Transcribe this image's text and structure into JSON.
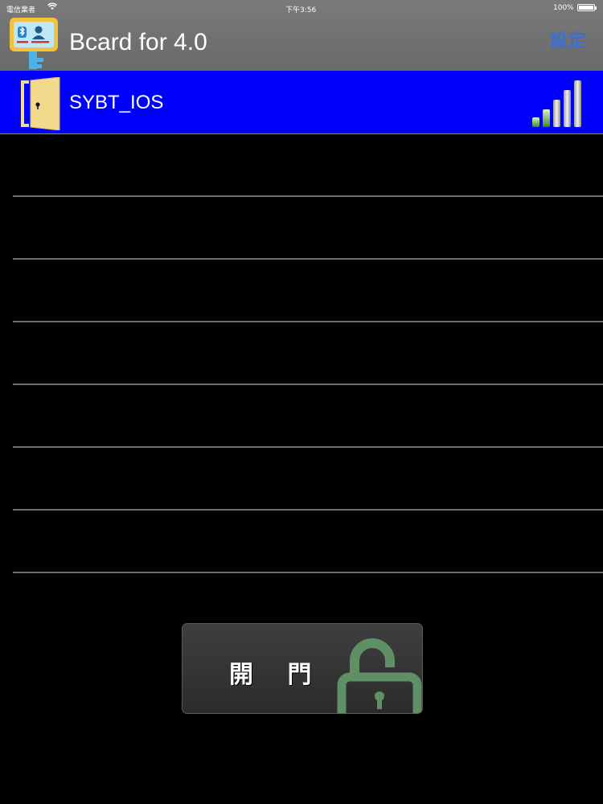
{
  "status_bar": {
    "carrier": "電信業者",
    "time": "下午3:56",
    "battery": "100%"
  },
  "nav": {
    "title": "Bcard for 4.0",
    "settings_label": "設定",
    "app_icon": "bluetooth-card-key-icon"
  },
  "devices": [
    {
      "name": "SYBT_IOS",
      "icon": "door-icon",
      "signal_icon": "signal-strength-icon",
      "selected": true,
      "row_color": "#0000ff"
    }
  ],
  "empty_rows": 7,
  "open_button": {
    "label": "開 門",
    "icon": "unlocked-padlock-icon",
    "icon_color": "#5f8f64"
  },
  "colors": {
    "nav_bar": "#707070",
    "accent": "#3b6fd6",
    "background": "#000000"
  }
}
